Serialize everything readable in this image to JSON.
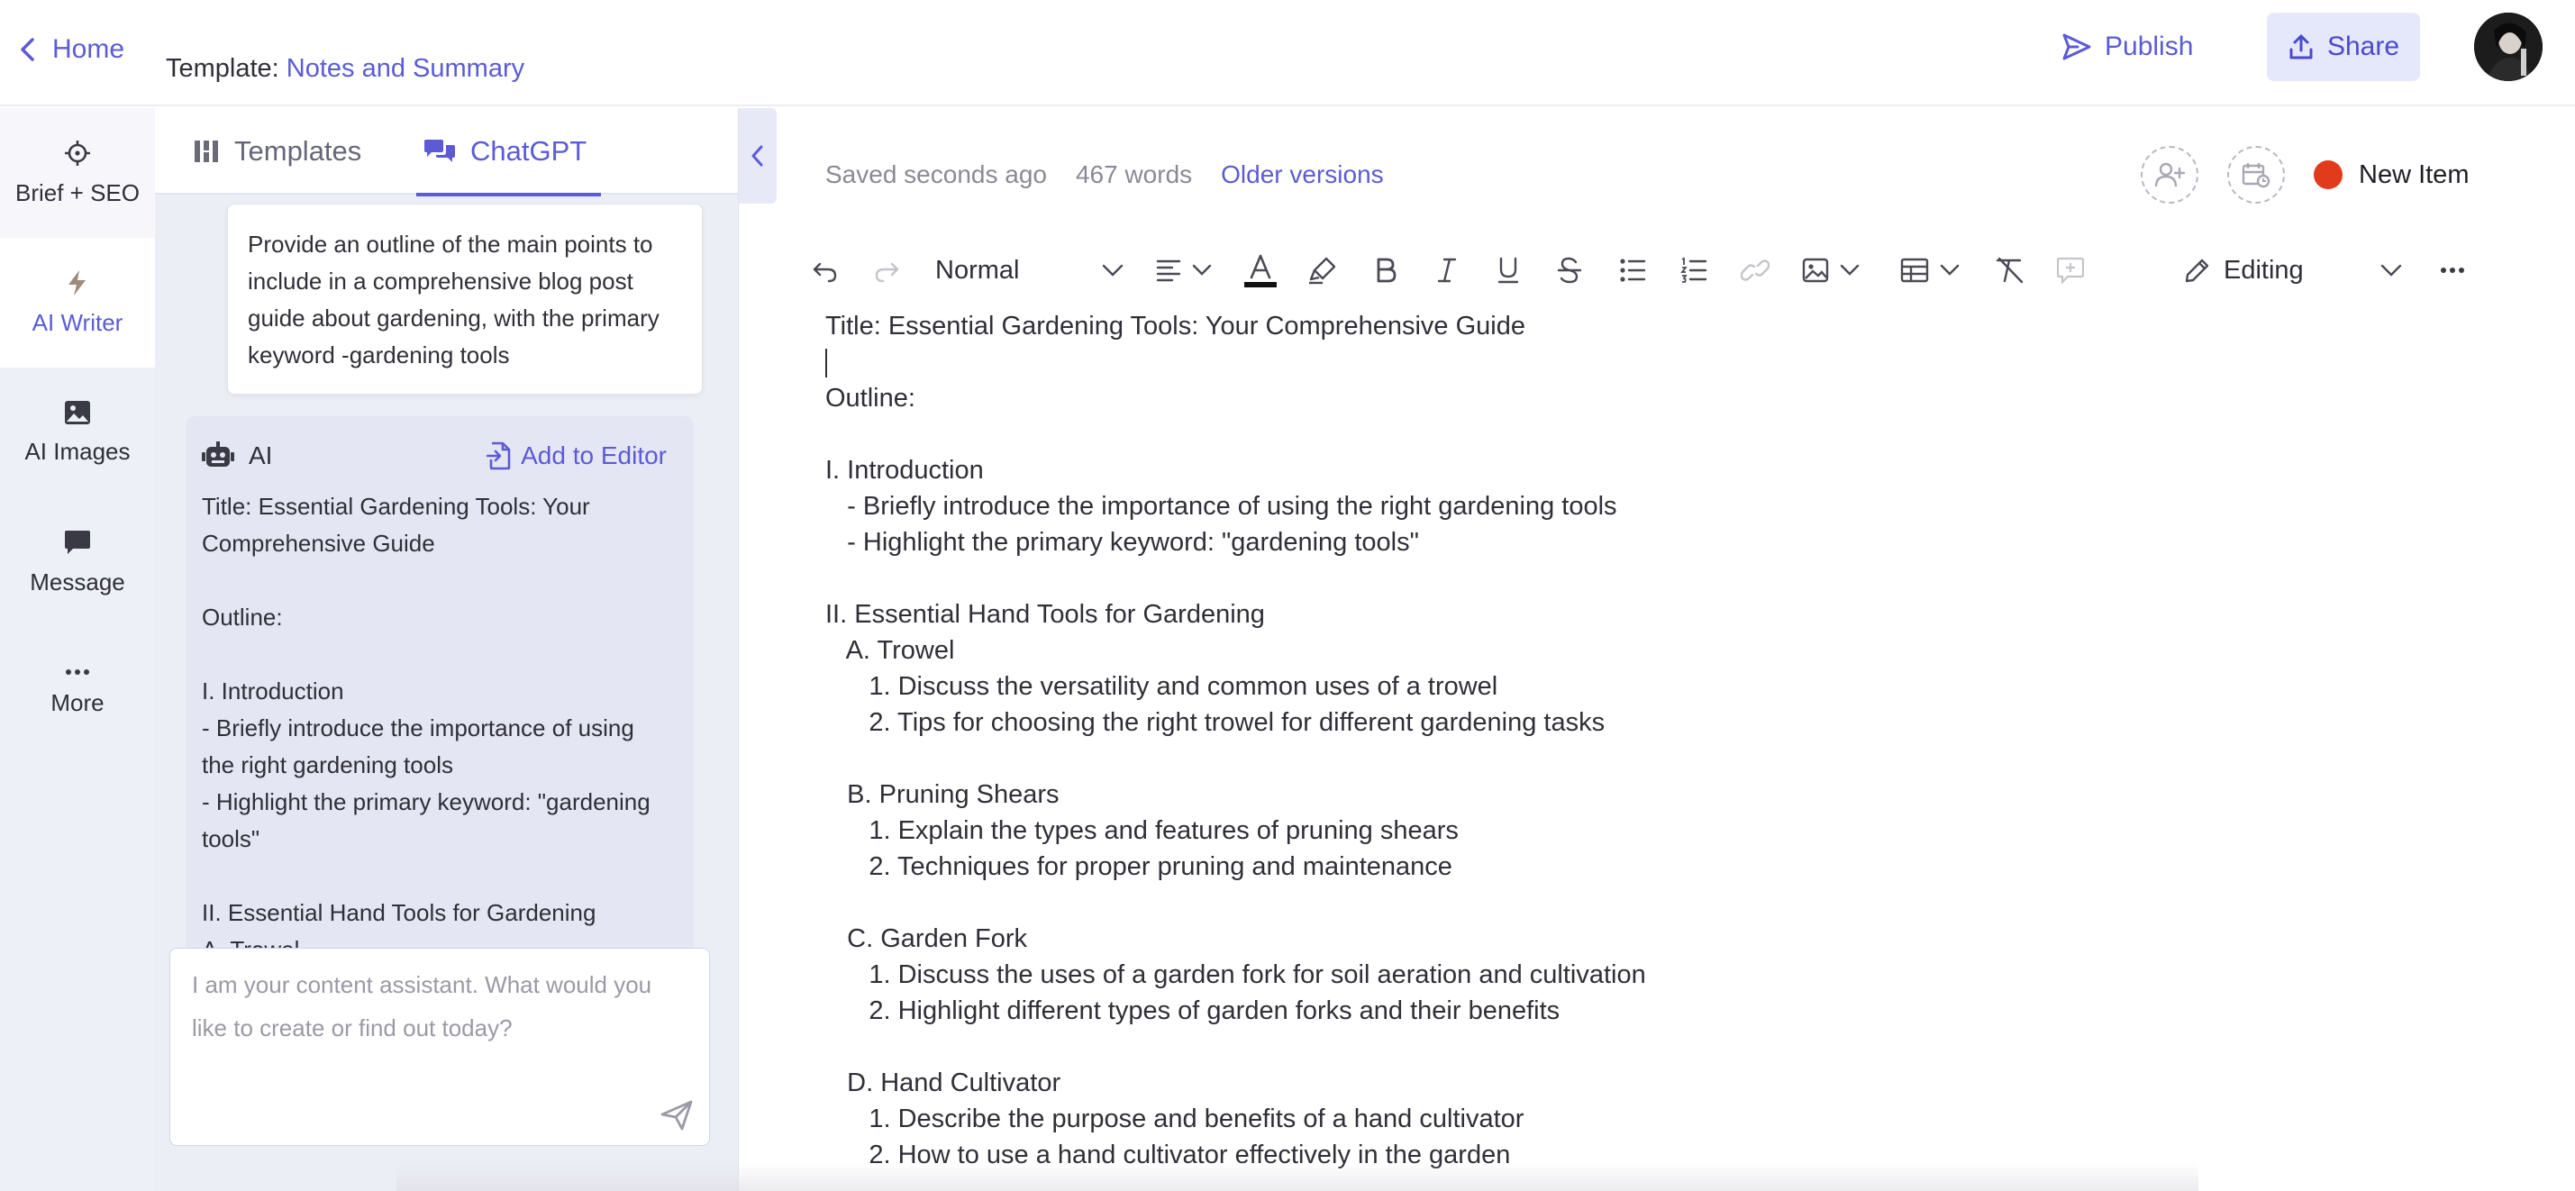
{
  "header": {
    "home_label": "Home",
    "template_prefix": "Template:",
    "template_name": "Notes and Summary",
    "publish_label": "Publish",
    "share_label": "Share"
  },
  "nav": {
    "items": [
      {
        "label": "Brief + SEO",
        "icon": "crosshair-icon"
      },
      {
        "label": "AI Writer",
        "icon": "lightning-icon"
      },
      {
        "label": "AI Images",
        "icon": "image-icon"
      },
      {
        "label": "Message",
        "icon": "chat-bubble-icon"
      },
      {
        "label": "More",
        "icon": "dots-icon"
      }
    ],
    "active_index": 1
  },
  "chat": {
    "tabs": [
      {
        "label": "Templates",
        "icon": "grid-icon"
      },
      {
        "label": "ChatGPT",
        "icon": "chat-icon"
      }
    ],
    "active_tab": 1,
    "user_message": "Provide an outline of the main points to include in a comprehensive blog post guide about gardening, with the primary keyword -gardening tools",
    "ai_label": "AI",
    "add_to_editor_label": "Add to Editor",
    "ai_text": "Title: Essential Gardening Tools: Your Comprehensive Guide\n\nOutline:\n\nI. Introduction\n   - Briefly introduce the importance of using the right gardening tools\n   - Highlight the primary keyword: \"gardening tools\"\n\nII. Essential Hand Tools for Gardening\n   A. Trowel",
    "input_placeholder": "I am your content assistant. What would you like to create or find out today?"
  },
  "editor": {
    "saved_status": "Saved seconds ago",
    "word_count": "467 words",
    "older_versions_label": "Older versions",
    "new_item_label": "New Item",
    "status_color": "#e23b1b",
    "paragraph_style": "Normal",
    "mode_label": "Editing",
    "lines": [
      "Title: Essential Gardening Tools: Your Comprehensive Guide",
      "",
      "Outline:",
      "",
      "I. Introduction",
      "   - Briefly introduce the importance of using the right gardening tools",
      "   - Highlight the primary keyword: \"gardening tools\"",
      "",
      "II. Essential Hand Tools for Gardening",
      "   A. Trowel",
      "      1. Discuss the versatility and common uses of a trowel",
      "      2. Tips for choosing the right trowel for different gardening tasks",
      "",
      "   B. Pruning Shears",
      "      1. Explain the types and features of pruning shears",
      "      2. Techniques for proper pruning and maintenance",
      "",
      "   C. Garden Fork",
      "      1. Discuss the uses of a garden fork for soil aeration and cultivation",
      "      2. Highlight different types of garden forks and their benefits",
      "",
      "   D. Hand Cultivator",
      "      1. Describe the purpose and benefits of a hand cultivator",
      "      2. How to use a hand cultivator effectively in the garden"
    ]
  },
  "colors": {
    "accent": "#5b5bd6",
    "share_bg": "#e5e7fb",
    "nav_bg": "#eef0f8",
    "panel_bg": "#eceef6",
    "ai_card_bg": "#e4e6f4"
  }
}
